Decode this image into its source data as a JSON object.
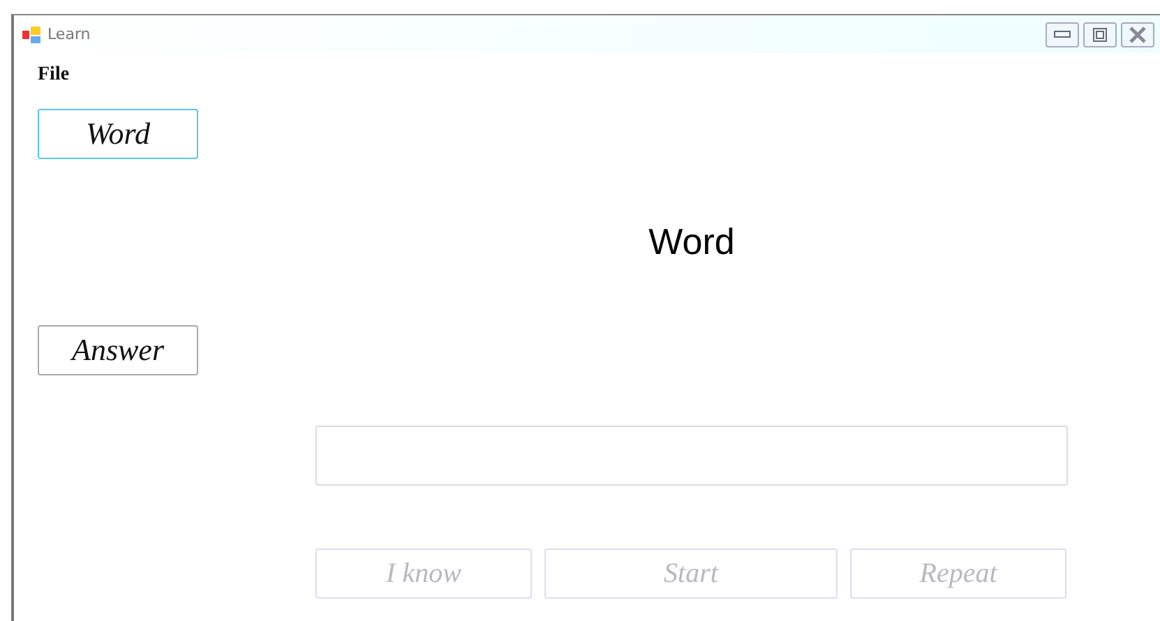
{
  "window": {
    "title": "Learn"
  },
  "menu": [
    {
      "label": "File"
    }
  ],
  "side_buttons": [
    {
      "label": "Word",
      "focused": true
    },
    {
      "label": "Answer",
      "focused": false
    }
  ],
  "word_label": "Word",
  "buttons": [
    {
      "label": "I know",
      "disabled": true
    },
    {
      "label": "Start",
      "disabled": true
    },
    {
      "label": "Repeat",
      "disabled": true
    }
  ]
}
